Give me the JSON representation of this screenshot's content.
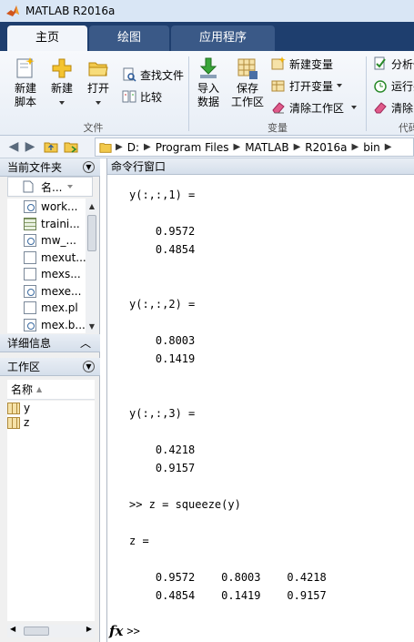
{
  "window": {
    "title": "MATLAB R2016a"
  },
  "ribbon": {
    "tabs": [
      {
        "label": "主页",
        "active": true
      },
      {
        "label": "绘图",
        "active": false
      },
      {
        "label": "应用程序",
        "active": false
      }
    ],
    "file_group": {
      "label": "文件",
      "new_script": "新建\n脚本",
      "new": "新建",
      "open": "打开",
      "find_files": "查找文件",
      "compare": "比较"
    },
    "variable_group": {
      "label": "变量",
      "import_data": "导入\n数据",
      "save_workspace": "保存\n工作区",
      "new_variable": "新建变量",
      "open_variable": "打开变量",
      "clear_workspace": "清除工作区"
    },
    "code_group": {
      "label": "代码",
      "analyze": "分析代",
      "run": "运行并",
      "clear": "清除"
    }
  },
  "address": {
    "crumbs": [
      "D:",
      "Program Files",
      "MATLAB",
      "R2016a",
      "bin"
    ]
  },
  "current_folder": {
    "title": "当前文件夹",
    "name_header": "名...",
    "files": [
      {
        "name": "work...",
        "icon": "gear-file-icon"
      },
      {
        "name": "traini...",
        "icon": "grid-file-icon"
      },
      {
        "name": "mw_...",
        "icon": "gear-file-icon"
      },
      {
        "name": "mexut...",
        "icon": "file-icon"
      },
      {
        "name": "mexs...",
        "icon": "file-icon"
      },
      {
        "name": "mexe...",
        "icon": "gear-file-icon"
      },
      {
        "name": "mex.pl",
        "icon": "file-icon"
      },
      {
        "name": "mex.b...",
        "icon": "gear-file-icon"
      }
    ]
  },
  "details": {
    "title": "详细信息"
  },
  "workspace": {
    "title": "工作区",
    "name_header": "名称",
    "variables": [
      "y",
      "z"
    ]
  },
  "command_window": {
    "title": "命令行窗口",
    "lines": [
      "y(:,:,1) =",
      "    0.9572",
      "    0.4854",
      "y(:,:,2) =",
      "    0.8003",
      "    0.1419",
      "y(:,:,3) =",
      "    0.4218",
      "    0.9157",
      ">> z = squeeze(y)",
      "z =",
      "    0.9572    0.8003    0.4218",
      "    0.4854    0.1419    0.9157"
    ],
    "fx_label": "fx",
    "prompt": ">>"
  },
  "colors": {
    "ribbon_tab_bar": "#1e3e6e",
    "title_bar": "#d9e6f5"
  }
}
